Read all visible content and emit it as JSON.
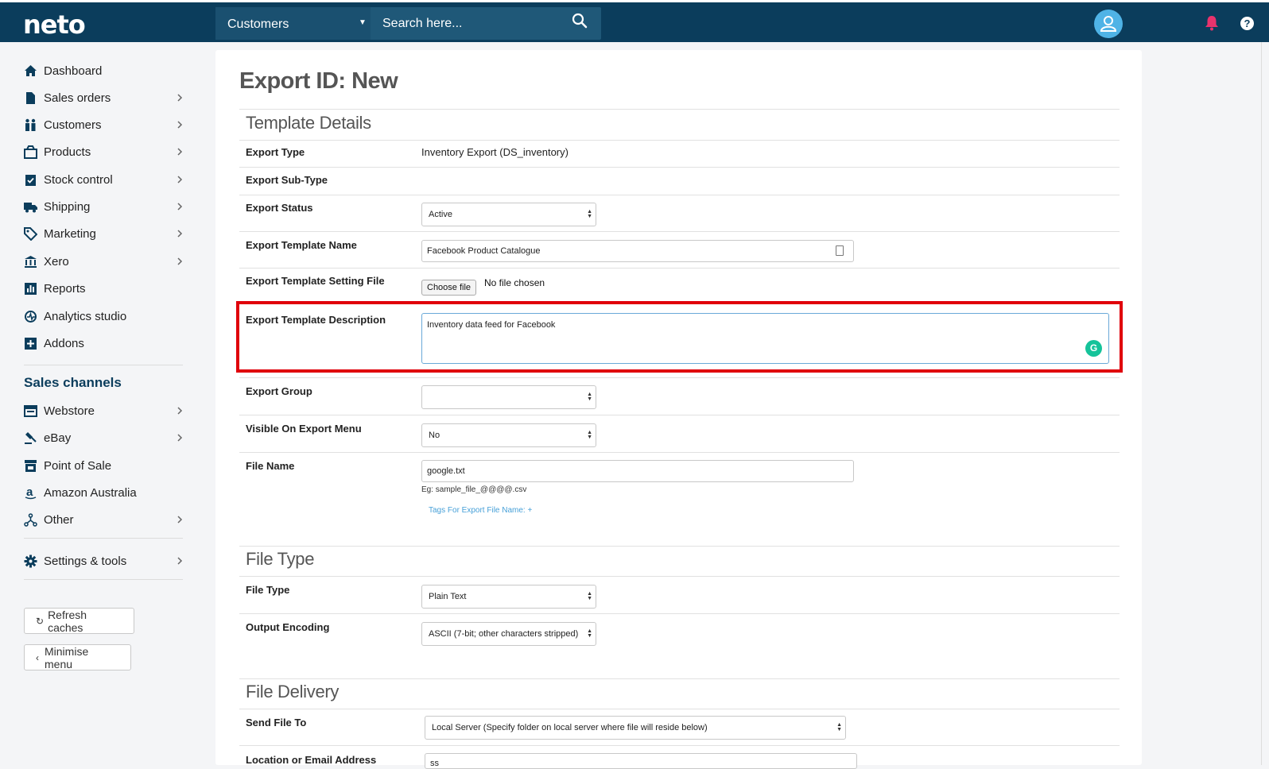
{
  "topbar": {
    "logo": "neto",
    "search_category": "Customers",
    "search_placeholder": "Search here...",
    "colors": {
      "bar": "#0b3d5c",
      "accent": "#4fb3e6",
      "bell": "#e8336d"
    }
  },
  "sidebar": {
    "items": [
      {
        "label": "Dashboard",
        "icon": "home-icon",
        "chevron": false
      },
      {
        "label": "Sales orders",
        "icon": "document-icon",
        "chevron": true
      },
      {
        "label": "Customers",
        "icon": "people-icon",
        "chevron": true
      },
      {
        "label": "Products",
        "icon": "box-icon",
        "chevron": true
      },
      {
        "label": "Stock control",
        "icon": "clipboard-check-icon",
        "chevron": true
      },
      {
        "label": "Shipping",
        "icon": "truck-icon",
        "chevron": true
      },
      {
        "label": "Marketing",
        "icon": "tag-icon",
        "chevron": true
      },
      {
        "label": "Xero",
        "icon": "bank-icon",
        "chevron": true
      },
      {
        "label": "Reports",
        "icon": "bar-chart-icon",
        "chevron": false
      },
      {
        "label": "Analytics studio",
        "icon": "analytics-icon",
        "chevron": false
      },
      {
        "label": "Addons",
        "icon": "plus-square-icon",
        "chevron": false
      }
    ],
    "sales_channels_heading": "Sales channels",
    "channels": [
      {
        "label": "Webstore",
        "icon": "browser-icon",
        "chevron": true
      },
      {
        "label": "eBay",
        "icon": "gavel-icon",
        "chevron": true
      },
      {
        "label": "Point of Sale",
        "icon": "store-icon",
        "chevron": false
      },
      {
        "label": "Amazon Australia",
        "icon": "amazon-icon",
        "chevron": false
      },
      {
        "label": "Other",
        "icon": "network-icon",
        "chevron": true
      }
    ],
    "settings": {
      "label": "Settings & tools",
      "icon": "gear-icon",
      "chevron": true
    },
    "refresh_label": "Refresh caches",
    "minimise_label": "Minimise menu"
  },
  "main": {
    "title": "Export ID: New",
    "template_details": {
      "heading": "Template Details",
      "export_type_label": "Export Type",
      "export_type_value": "Inventory Export (DS_inventory)",
      "export_subtype_label": "Export Sub-Type",
      "export_status_label": "Export Status",
      "export_status_value": "Active",
      "template_name_label": "Export Template Name",
      "template_name_value": "Facebook Product Catalogue",
      "setting_file_label": "Export Template Setting File",
      "choose_file_label": "Choose file",
      "no_file_text": "No file chosen",
      "description_label": "Export Template Description",
      "description_value": "Inventory data feed for Facebook",
      "export_group_label": "Export Group",
      "export_group_value": "",
      "visible_label": "Visible On Export Menu",
      "visible_value": "No",
      "file_name_label": "File Name",
      "file_name_value": "google.txt",
      "file_name_hint": "Eg: sample_file_@@@@.csv",
      "tags_link": "Tags For Export File Name: +"
    },
    "file_type": {
      "heading": "File Type",
      "file_type_label": "File Type",
      "file_type_value": "Plain Text",
      "encoding_label": "Output Encoding",
      "encoding_value": "ASCII (7-bit; other characters stripped)"
    },
    "file_delivery": {
      "heading": "File Delivery",
      "send_to_label": "Send File To",
      "send_to_value": "Local Server (Specify folder on local server where file will reside below)",
      "location_label": "Location or Email Address",
      "location_value": "ss"
    },
    "highlight_color": "#e0000b"
  }
}
